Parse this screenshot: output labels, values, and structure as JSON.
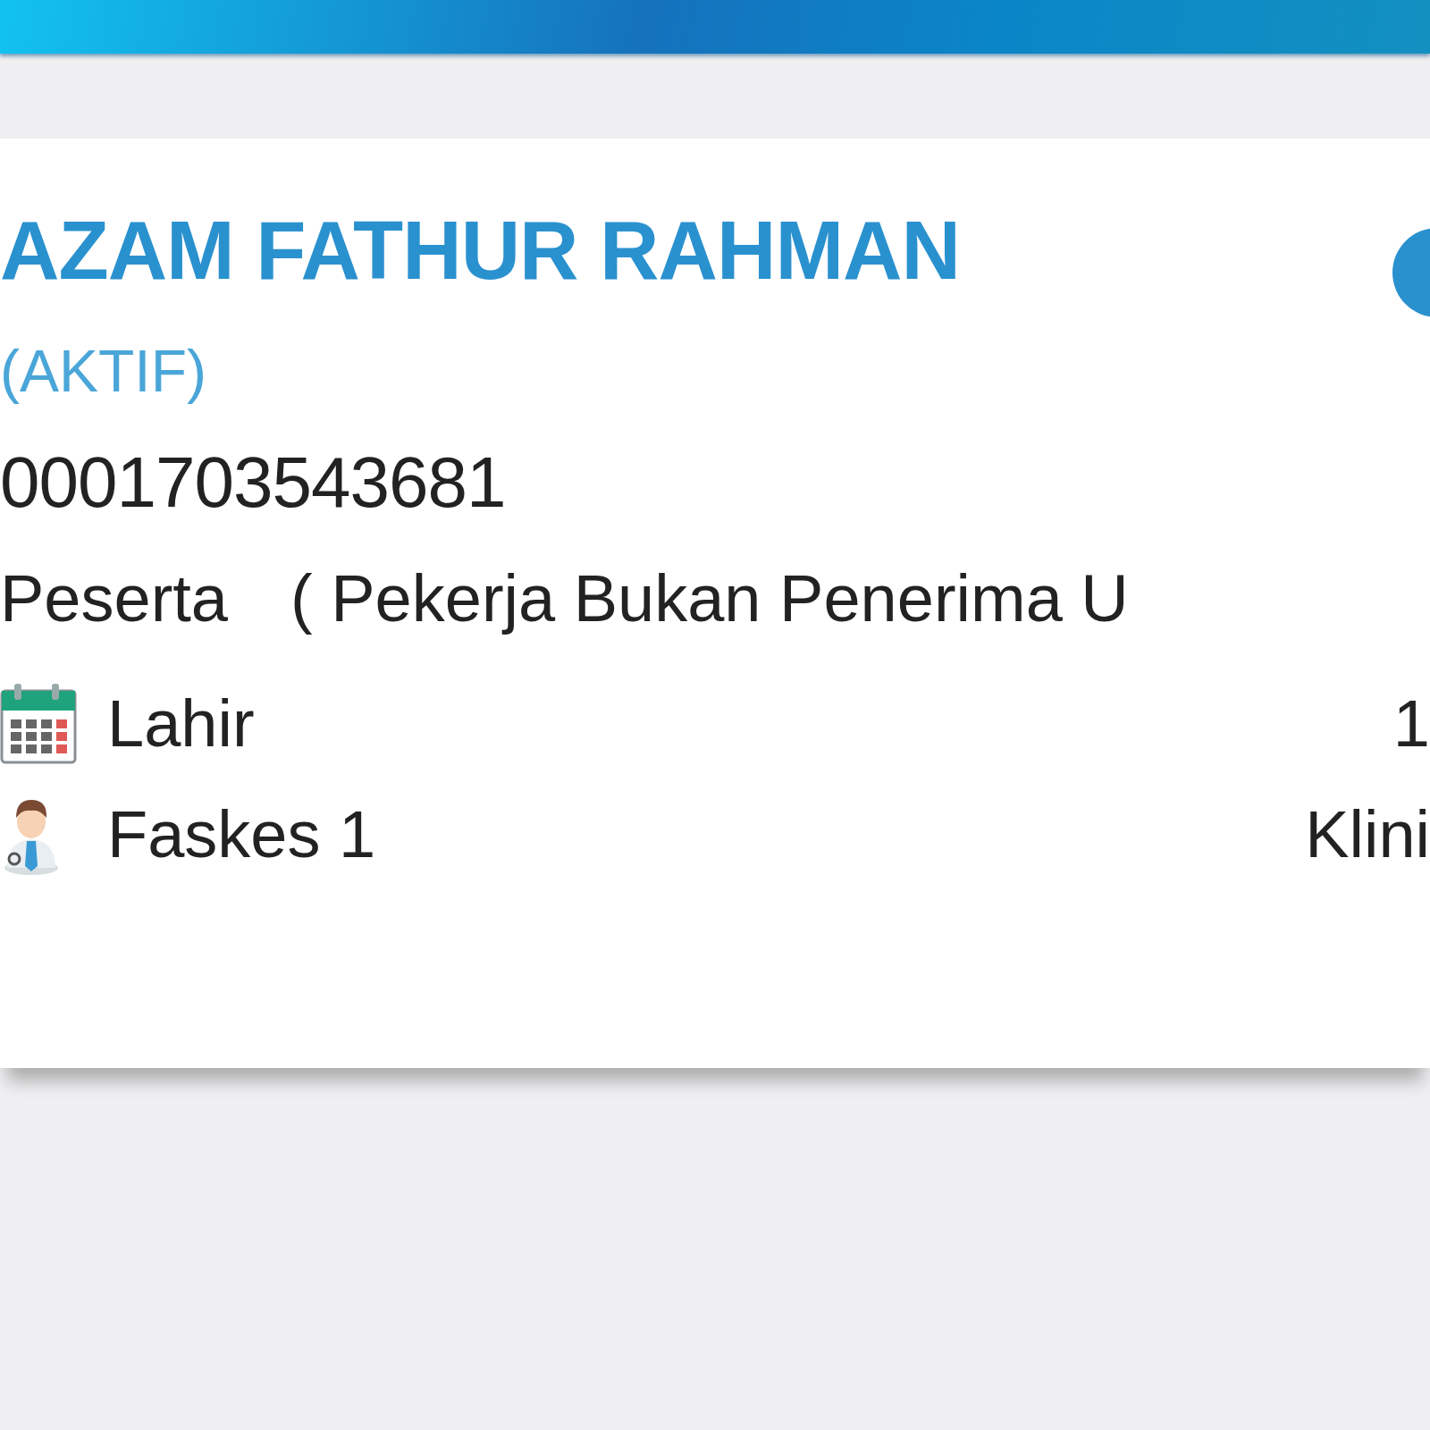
{
  "card": {
    "name": "AZAM FATHUR RAHMAN",
    "status": "(AKTIF)",
    "number": "0001703543681",
    "membership": {
      "label": "Peserta",
      "type": "( Pekerja Bukan Penerima U"
    },
    "details": [
      {
        "kind": "calendar",
        "label": "Lahir",
        "value": "1"
      },
      {
        "kind": "doctor",
        "label": "Faskes 1",
        "value": "Klini"
      }
    ]
  }
}
